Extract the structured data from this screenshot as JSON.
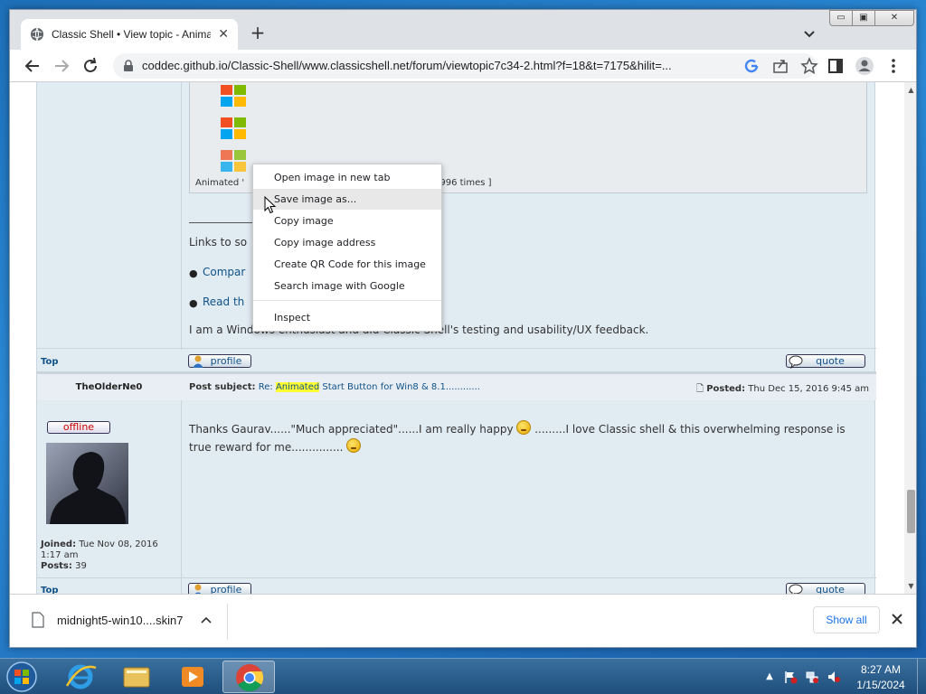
{
  "browser": {
    "tab_title": "Classic Shell • View topic - Anima",
    "new_tab": "+",
    "url": "coddec.github.io/Classic-Shell/www.classicshell.net/forum/viewtopic7c34-2.html?f=18&t=7175&hilit=...",
    "window_controls": {
      "minimize": "▭",
      "maximize": "▣",
      "close": "✕"
    }
  },
  "page": {
    "image_caption_left": "Animated '",
    "image_caption_right": "7996 times ]",
    "links_heading": "Links to so",
    "bullet1": "Compar",
    "bullet2": "Read th",
    "sig_text": "I am a Windows enthusiast and did Classic Shell's testing and usability/UX feedback.",
    "top_link": "Top",
    "profile_btn": "profile",
    "quote_btn": "quote"
  },
  "post": {
    "author": "TheOlderNe0",
    "subject_label": "Post subject:",
    "subject_re": "Re:",
    "subject_highlight": "Animated",
    "subject_rest": "Start Button for Win8 & 8.1............",
    "posted_label": "Posted:",
    "posted_date": "Thu Dec 15, 2016 9:45 am",
    "status": "offline",
    "joined_label": "Joined:",
    "joined_value": "Tue Nov 08, 2016",
    "joined_time": "1:17 am",
    "posts_label": "Posts:",
    "posts_value": "39",
    "body_part1": "Thanks Gaurav......\"Much appreciated\"......I am really happy",
    "body_part2": ".........I love Classic shell & this overwhelming response is",
    "body_line2": "true reward for me..............."
  },
  "context_menu": {
    "items": [
      "Open image in new tab",
      "Save image as...",
      "Copy image",
      "Copy image address",
      "Create QR Code for this image",
      "Search image with Google"
    ],
    "inspect": "Inspect"
  },
  "download_bar": {
    "file_name": "midnight5-win10....skin7",
    "show_all": "Show all"
  },
  "taskbar": {
    "time": "8:27 AM",
    "date": "1/15/2024"
  },
  "colors": {
    "forum_bg": "#e1ebf2",
    "link": "#105289",
    "highlight": "#ffff33",
    "chrome_blue": "#1a73e8"
  }
}
